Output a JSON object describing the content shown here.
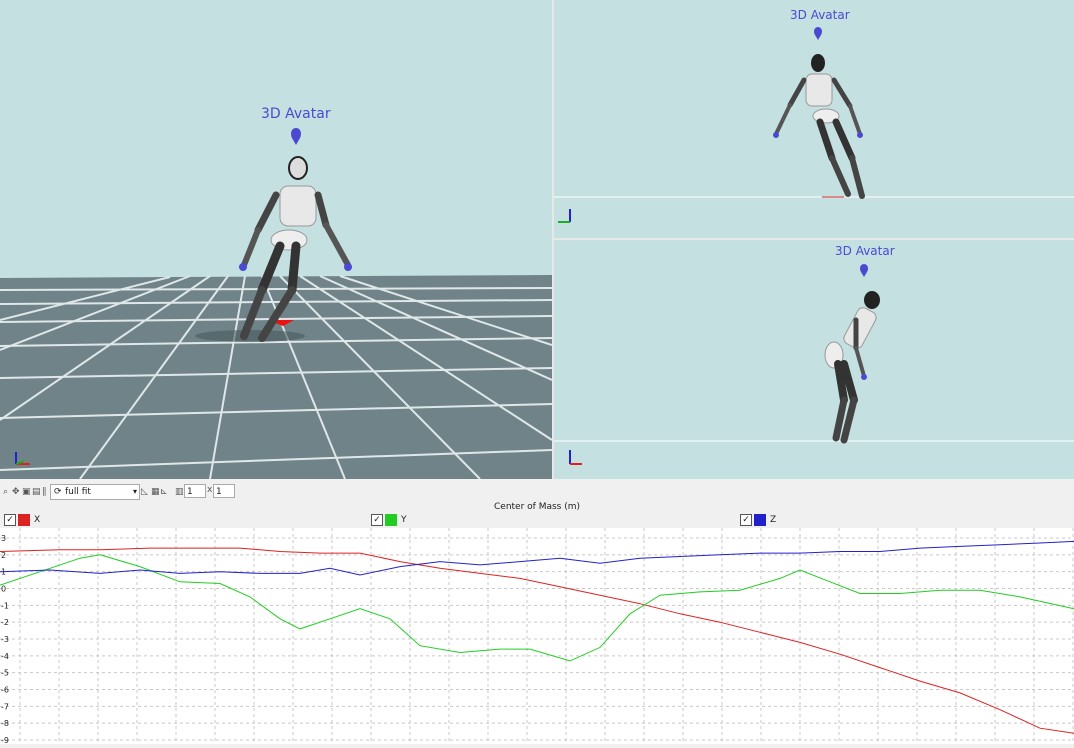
{
  "viewports": {
    "main": {
      "label": "3D Avatar"
    },
    "top": {
      "label": "3D Avatar"
    },
    "bottom": {
      "label": "3D Avatar"
    }
  },
  "toolbar": {
    "fit_mode": "full fit",
    "rows": "1",
    "cols": "1",
    "times": "x"
  },
  "plot": {
    "title": "Center of Mass (m)",
    "legend": [
      {
        "label": "X",
        "color": "#dd2222",
        "checked": "✓"
      },
      {
        "label": "Y",
        "color": "#22cc22",
        "checked": "✓"
      },
      {
        "label": "Z",
        "color": "#2222cc",
        "checked": "✓"
      }
    ],
    "y_ticks": [
      "3",
      "2",
      "1",
      "0",
      "-1",
      "-2",
      "-3",
      "-4",
      "-5",
      "-6",
      "-7",
      "-8",
      "-9"
    ]
  },
  "chart_data": {
    "type": "line",
    "title": "Center of Mass (m)",
    "ylim": [
      -9,
      3
    ],
    "grid": true,
    "series": [
      {
        "name": "X",
        "color": "#dd2222",
        "points": [
          [
            0,
            2.2
          ],
          [
            60,
            2.3
          ],
          [
            100,
            2.3
          ],
          [
            150,
            2.4
          ],
          [
            200,
            2.4
          ],
          [
            240,
            2.4
          ],
          [
            280,
            2.2
          ],
          [
            320,
            2.1
          ],
          [
            360,
            2.1
          ],
          [
            400,
            1.6
          ],
          [
            440,
            1.2
          ],
          [
            480,
            0.9
          ],
          [
            520,
            0.6
          ],
          [
            560,
            0.1
          ],
          [
            600,
            -0.4
          ],
          [
            640,
            -0.9
          ],
          [
            680,
            -1.5
          ],
          [
            720,
            -2.0
          ],
          [
            760,
            -2.6
          ],
          [
            800,
            -3.2
          ],
          [
            840,
            -3.9
          ],
          [
            880,
            -4.7
          ],
          [
            920,
            -5.5
          ],
          [
            960,
            -6.2
          ],
          [
            1000,
            -7.2
          ],
          [
            1040,
            -8.3
          ],
          [
            1074,
            -8.6
          ]
        ]
      },
      {
        "name": "Y",
        "color": "#22cc22",
        "points": [
          [
            0,
            0.2
          ],
          [
            40,
            1.0
          ],
          [
            80,
            1.8
          ],
          [
            100,
            2.0
          ],
          [
            140,
            1.3
          ],
          [
            180,
            0.4
          ],
          [
            220,
            0.3
          ],
          [
            250,
            -0.5
          ],
          [
            280,
            -1.8
          ],
          [
            300,
            -2.4
          ],
          [
            330,
            -1.8
          ],
          [
            360,
            -1.2
          ],
          [
            390,
            -1.8
          ],
          [
            420,
            -3.4
          ],
          [
            460,
            -3.8
          ],
          [
            500,
            -3.6
          ],
          [
            530,
            -3.6
          ],
          [
            570,
            -4.3
          ],
          [
            600,
            -3.5
          ],
          [
            630,
            -1.5
          ],
          [
            660,
            -0.4
          ],
          [
            700,
            -0.2
          ],
          [
            740,
            -0.1
          ],
          [
            780,
            0.6
          ],
          [
            800,
            1.1
          ],
          [
            830,
            0.4
          ],
          [
            860,
            -0.3
          ],
          [
            900,
            -0.3
          ],
          [
            940,
            -0.1
          ],
          [
            980,
            -0.1
          ],
          [
            1020,
            -0.5
          ],
          [
            1074,
            -1.2
          ]
        ]
      },
      {
        "name": "Z",
        "color": "#2222cc",
        "points": [
          [
            0,
            1.0
          ],
          [
            50,
            1.1
          ],
          [
            100,
            0.9
          ],
          [
            140,
            1.1
          ],
          [
            180,
            0.9
          ],
          [
            220,
            1.0
          ],
          [
            260,
            0.9
          ],
          [
            300,
            0.9
          ],
          [
            330,
            1.2
          ],
          [
            360,
            0.8
          ],
          [
            400,
            1.3
          ],
          [
            440,
            1.6
          ],
          [
            480,
            1.4
          ],
          [
            520,
            1.6
          ],
          [
            560,
            1.8
          ],
          [
            600,
            1.5
          ],
          [
            640,
            1.8
          ],
          [
            680,
            1.9
          ],
          [
            720,
            2.0
          ],
          [
            760,
            2.1
          ],
          [
            800,
            2.1
          ],
          [
            840,
            2.2
          ],
          [
            880,
            2.2
          ],
          [
            920,
            2.4
          ],
          [
            960,
            2.5
          ],
          [
            1000,
            2.6
          ],
          [
            1040,
            2.7
          ],
          [
            1074,
            2.8
          ]
        ]
      }
    ]
  }
}
